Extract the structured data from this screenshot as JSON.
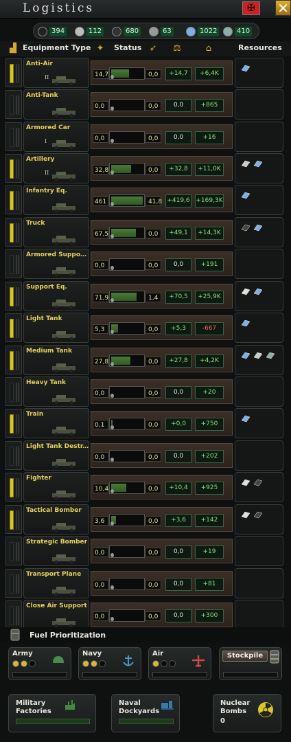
{
  "title": "Logistics",
  "resources": [
    {
      "icon": "oil-icon",
      "value": "394"
    },
    {
      "icon": "aluminium-icon",
      "value": "112"
    },
    {
      "icon": "rubber-icon",
      "value": "680"
    },
    {
      "icon": "tungsten-icon",
      "value": "63"
    },
    {
      "icon": "steel-icon",
      "value": "1022"
    },
    {
      "icon": "chromium-icon",
      "value": "410"
    }
  ],
  "header": {
    "equipment_type": "Equipment Type",
    "status": "Status",
    "resources": "Resources"
  },
  "rows": [
    {
      "name": "Anti-Air",
      "tier": "II",
      "stock": "14,7",
      "fill": 0.55,
      "prod": "0,0",
      "net": "+14,7",
      "total": "+6,4K",
      "active": true,
      "res": [
        "steel"
      ]
    },
    {
      "name": "Anti-Tank",
      "tier": "",
      "stock": "0,0",
      "fill": 0,
      "prod": "0,0",
      "net": "0,0",
      "total": "+865",
      "active": false,
      "res": []
    },
    {
      "name": "Armored Car",
      "tier": "I",
      "stock": "0,0",
      "fill": 0,
      "prod": "0,0",
      "net": "0,0",
      "total": "+16",
      "active": false,
      "res": []
    },
    {
      "name": "Artillery",
      "tier": "II",
      "stock": "32,8",
      "fill": 0.6,
      "prod": "0,0",
      "net": "+32,8",
      "total": "+11,0K",
      "active": true,
      "res": [
        "tungsten",
        "steel"
      ]
    },
    {
      "name": "Infantry Eq.",
      "tier": "",
      "stock": "461",
      "fill": 0.95,
      "prod": "41,8",
      "net": "+419,6",
      "total": "+169,3K",
      "active": true,
      "res": [
        "steel"
      ]
    },
    {
      "name": "Truck",
      "tier": "",
      "stock": "67,5",
      "fill": 0.75,
      "prod": "0,0",
      "net": "+49,1",
      "total": "+14,3K",
      "active": true,
      "res": [
        "rubber",
        "steel"
      ]
    },
    {
      "name": "Armored Support ...",
      "tier": "",
      "stock": "0,0",
      "fill": 0,
      "prod": "0,0",
      "net": "0,0",
      "total": "+191",
      "active": false,
      "res": []
    },
    {
      "name": "Support Eq.",
      "tier": "",
      "stock": "71,9",
      "fill": 0.78,
      "prod": "1,4",
      "net": "+70,5",
      "total": "+25,9K",
      "active": true,
      "res": [
        "aluminium",
        "steel"
      ]
    },
    {
      "name": "Light Tank",
      "tier": "",
      "stock": "5,3",
      "fill": 0.2,
      "prod": "0,0",
      "net": "+5,3",
      "total": "-667",
      "active": true,
      "res": [
        "steel"
      ]
    },
    {
      "name": "Medium Tank",
      "tier": "",
      "stock": "27,8",
      "fill": 0.58,
      "prod": "0,0",
      "net": "+27,8",
      "total": "+4,2K",
      "active": true,
      "res": [
        "steel",
        "tungsten",
        "chromium"
      ]
    },
    {
      "name": "Heavy Tank",
      "tier": "",
      "stock": "0,0",
      "fill": 0,
      "prod": "0,0",
      "net": "0,0",
      "total": "+20",
      "active": false,
      "res": []
    },
    {
      "name": "Train",
      "tier": "",
      "stock": "0,1",
      "fill": 0.05,
      "prod": "0,0",
      "net": "+0,0",
      "total": "+750",
      "active": true,
      "res": [
        "steel"
      ]
    },
    {
      "name": "Light Tank Destr...",
      "tier": "",
      "stock": "0,0",
      "fill": 0,
      "prod": "0,0",
      "net": "0,0",
      "total": "+202",
      "active": false,
      "res": []
    },
    {
      "name": "Fighter",
      "tier": "",
      "stock": "10,4",
      "fill": 0.45,
      "prod": "0,0",
      "net": "+10,4",
      "total": "+925",
      "active": true,
      "res": [
        "aluminium",
        "rubber"
      ]
    },
    {
      "name": "Tactical Bomber",
      "tier": "",
      "stock": "3,6",
      "fill": 0.15,
      "prod": "0,0",
      "net": "+3,6",
      "total": "+142",
      "active": true,
      "res": [
        "aluminium",
        "rubber"
      ]
    },
    {
      "name": "Strategic Bomber",
      "tier": "",
      "stock": "0,0",
      "fill": 0,
      "prod": "0,0",
      "net": "0,0",
      "total": "+19",
      "active": false,
      "res": []
    },
    {
      "name": "Transport Plane",
      "tier": "",
      "stock": "0,0",
      "fill": 0,
      "prod": "0,0",
      "net": "0,0",
      "total": "+81",
      "active": false,
      "res": []
    },
    {
      "name": "Close Air Support",
      "tier": "",
      "stock": "0,0",
      "fill": 0,
      "prod": "0,0",
      "net": "0,0",
      "total": "+300",
      "active": false,
      "res": []
    }
  ],
  "fuel": {
    "title": "Fuel Prioritization"
  },
  "branches": [
    {
      "label": "Army",
      "level": 2,
      "icon": "helmet-icon"
    },
    {
      "label": "Navy",
      "level": 2,
      "icon": "anchor-icon"
    },
    {
      "label": "Air",
      "level": 1,
      "icon": "plane-icon"
    }
  ],
  "stockpile": "Stockpile",
  "bottom": {
    "military": "Military\nFactories",
    "naval": "Naval\nDockyards",
    "nuclear": "Nuclear\nBombs",
    "nuclear_count": "0"
  },
  "colors": {
    "accent": "#d9c52a",
    "positive": "#8ee07e",
    "negative": "#f06060"
  }
}
